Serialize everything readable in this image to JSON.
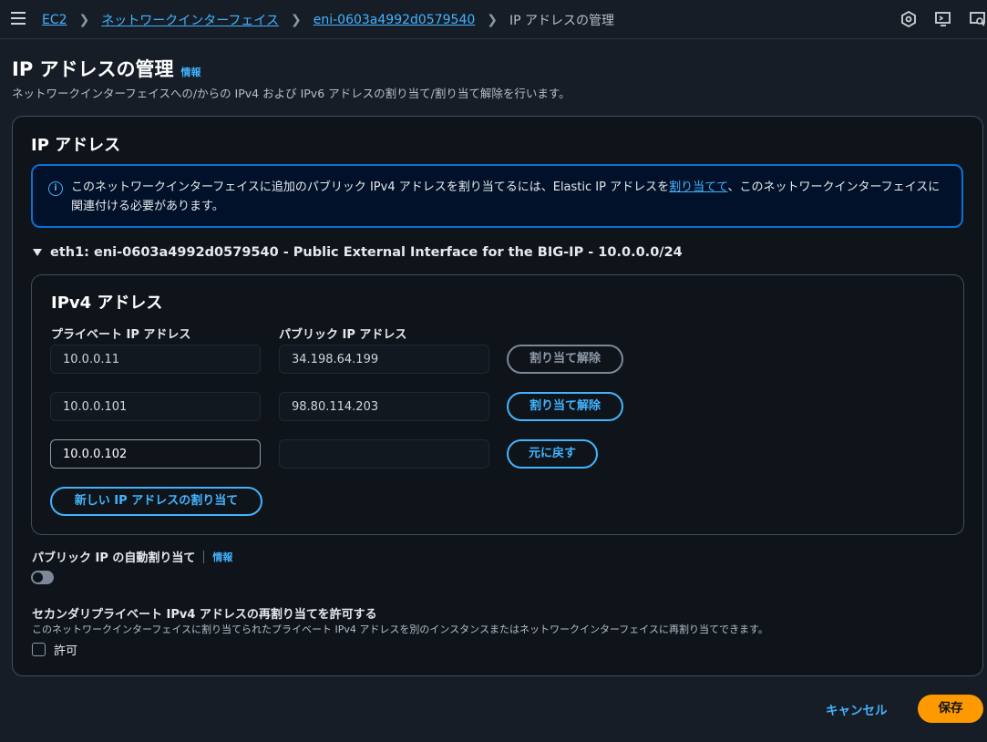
{
  "breadcrumb": {
    "items": [
      "EC2",
      "ネットワークインターフェイス",
      "eni-0603a4992d0579540"
    ],
    "current": "IP アドレスの管理"
  },
  "header": {
    "title": "IP アドレスの管理",
    "info": "情報",
    "description": "ネットワークインターフェイスへの/からの IPv4 および IPv6 アドレスの割り当て/割り当て解除を行います。"
  },
  "panel": {
    "title": "IP アドレス",
    "alert": {
      "text_before": "このネットワークインターフェイスに追加のパブリック IPv4 アドレスを割り当てるには、Elastic IP アドレスを",
      "link": "割り当てて",
      "text_after": "、このネットワークインターフェイスに関連付ける必要があります。"
    },
    "interface_label": "eth1: eni-0603a4992d0579540 - Public External Interface for the BIG-IP - 10.0.0.0/24",
    "ipv4": {
      "title": "IPv4 アドレス",
      "col_private": "プライベート IP アドレス",
      "col_public": "パブリック IP アドレス",
      "rows": [
        {
          "private": "10.0.0.11",
          "public": "34.198.64.199",
          "action": "割り当て解除"
        },
        {
          "private": "10.0.0.101",
          "public": "98.80.114.203",
          "action": "割り当て解除"
        },
        {
          "private": "10.0.0.102",
          "public": "",
          "action": "元に戻す"
        }
      ],
      "add_button": "新しい IP アドレスの割り当て"
    },
    "auto_assign": {
      "label": "パブリック IP の自動割り当て",
      "info": "情報",
      "enabled": false
    },
    "reassign": {
      "title": "セカンダリプライベート IPv4 アドレスの再割り当てを許可する",
      "description": "このネットワークインターフェイスに割り当てられたプライベート IPv4 アドレスを別のインスタンスまたはネットワークインターフェイスに再割り当てできます。",
      "checkbox_label": "許可",
      "checked": false
    }
  },
  "footer": {
    "cancel": "キャンセル",
    "save": "保存"
  },
  "colors": {
    "accent": "#42b4ff",
    "primary_button": "#ff9900",
    "background": "#161d26"
  }
}
